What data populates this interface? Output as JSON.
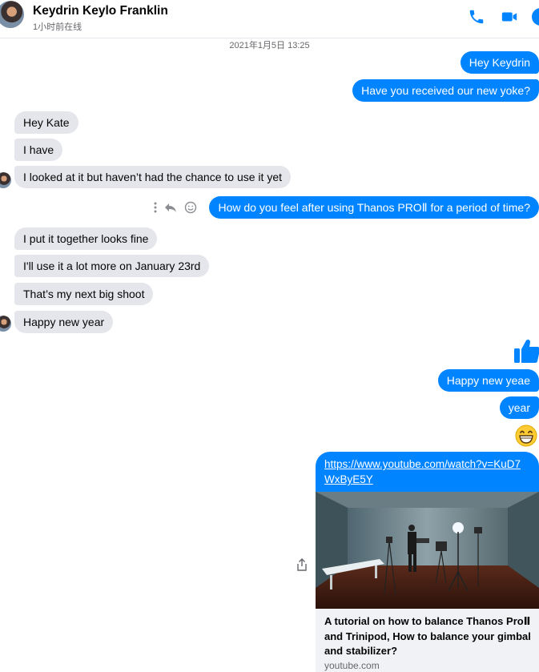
{
  "header": {
    "contact_name": "Keydrin Keylo Franklin",
    "status": "1小时前在线"
  },
  "conversation": {
    "timestamp": "2021年1月5日 13:25",
    "messages": [
      {
        "text": "Hey Keydrin",
        "from": "me"
      },
      {
        "text": "Have you received our new yoke?",
        "from": "me"
      },
      {
        "text": "Hey Kate",
        "from": "them"
      },
      {
        "text": "I have",
        "from": "them"
      },
      {
        "text": "I looked at it but haven’t had the chance to use it yet",
        "from": "them"
      },
      {
        "text": "How do you feel after using Thanos PROⅡ for a period of time?",
        "from": "me"
      },
      {
        "text": "I put it together looks fine",
        "from": "them"
      },
      {
        "text": "I'll use it a lot more on January 23rd",
        "from": "them"
      },
      {
        "text": "That’s my next big shoot",
        "from": "them"
      },
      {
        "text": "Happy new year",
        "from": "them"
      },
      {
        "text": "Happy new yeae",
        "from": "me"
      },
      {
        "text": "year",
        "from": "me"
      }
    ],
    "reactions": {
      "like": "thumbs-up-icon",
      "emoji": "grinning-face-icon"
    },
    "link_card": {
      "url": "https://www.youtube.com/watch?v=KuD7WxByE5Y",
      "title": "A tutorial on how to balance Thanos ProⅡ and Trinipod, How to balance your gimbal and stabilizer?",
      "domain": "youtube.com"
    }
  },
  "colors": {
    "outgoing": "#0084ff",
    "incoming": "#e4e6eb",
    "accent": "#0084ff"
  }
}
